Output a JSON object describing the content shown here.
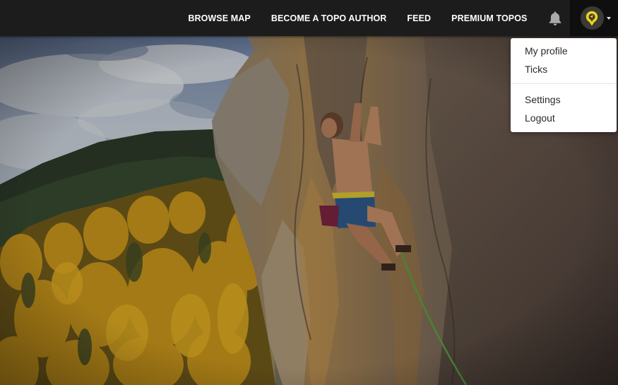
{
  "navbar": {
    "links": [
      "BROWSE MAP",
      "BECOME A TOPO AUTHOR",
      "FEED",
      "PREMIUM TOPOS"
    ],
    "notification_icon": "bell-icon",
    "avatar_icon": "map-pin-logo-icon"
  },
  "user_menu": {
    "group1": [
      "My profile",
      "Ticks"
    ],
    "group2": [
      "Settings",
      "Logout"
    ]
  },
  "hero": {
    "subject": "climber-on-rock-wall-photo"
  },
  "colors": {
    "navbar_bg": "#1c1c1c",
    "accent_yellow": "#f2d21a",
    "menu_bg": "#ffffff",
    "menu_text": "#2a2a2a"
  }
}
